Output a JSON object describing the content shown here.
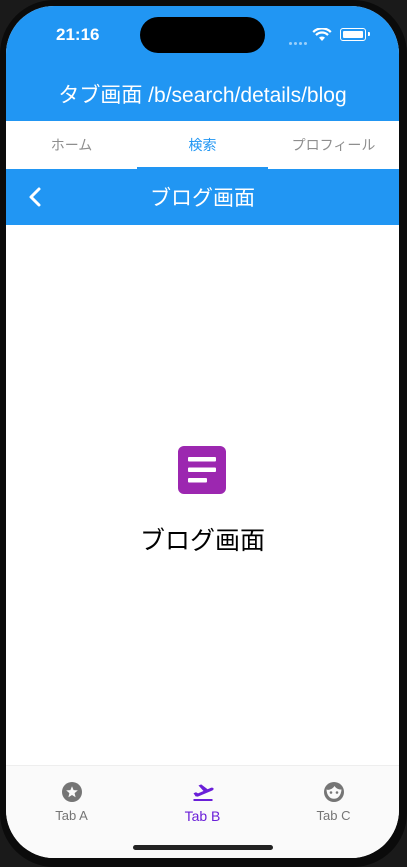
{
  "status": {
    "time": "21:16"
  },
  "appbar": {
    "title": "タブ画面 /b/search/details/blog"
  },
  "tabs": [
    {
      "label": "ホーム"
    },
    {
      "label": "検索"
    },
    {
      "label": "プロフィール"
    }
  ],
  "subbar": {
    "title": "ブログ画面"
  },
  "content": {
    "title": "ブログ画面",
    "icon": "article-icon",
    "icon_color": "#9c27b0"
  },
  "bottom_nav": [
    {
      "label": "Tab A",
      "icon": "star-circle-icon"
    },
    {
      "label": "Tab B",
      "icon": "airplane-takeoff-icon"
    },
    {
      "label": "Tab C",
      "icon": "face-icon"
    }
  ],
  "colors": {
    "primary": "#2196f3",
    "nav_active": "#6a1fd8",
    "nav_inactive": "#757575"
  }
}
